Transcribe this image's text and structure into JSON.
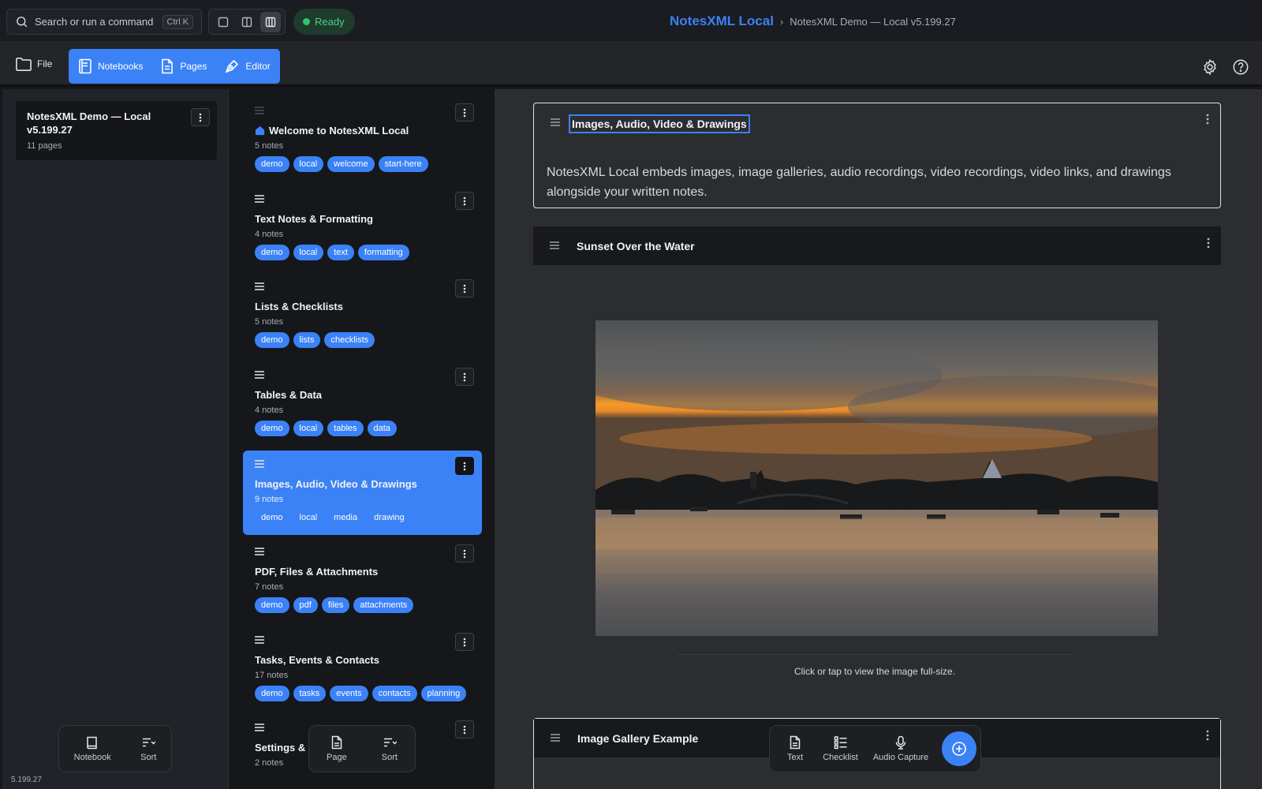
{
  "topbar": {
    "search_placeholder": "Search or run a command",
    "search_shortcut": "Ctrl K",
    "status": "Ready",
    "app_name": "NotesXML Local",
    "breadcrumb_separator": "›",
    "breadcrumb_current": "NotesXML Demo — Local v5.199.27"
  },
  "toolbar": {
    "file_label": "File",
    "notebooks_label": "Notebooks",
    "pages_label": "Pages",
    "editor_label": "Editor"
  },
  "notebooks": {
    "items": [
      {
        "title": "NotesXML Demo — Local v5.199.27",
        "pages": "11 pages"
      }
    ],
    "footer": {
      "notebook_label": "Notebook",
      "sort_label": "Sort"
    },
    "version": "5.199.27"
  },
  "pages": {
    "items": [
      {
        "title": "Welcome to NotesXML Local",
        "count": "5 notes",
        "tags": [
          "demo",
          "local",
          "welcome",
          "start-here"
        ]
      },
      {
        "title": "Text Notes & Formatting",
        "count": "4 notes",
        "tags": [
          "demo",
          "local",
          "text",
          "formatting"
        ]
      },
      {
        "title": "Lists & Checklists",
        "count": "5 notes",
        "tags": [
          "demo",
          "lists",
          "checklists"
        ]
      },
      {
        "title": "Tables & Data",
        "count": "4 notes",
        "tags": [
          "demo",
          "local",
          "tables",
          "data"
        ]
      },
      {
        "title": "Images, Audio, Video & Drawings",
        "count": "9 notes",
        "tags": [
          "demo",
          "local",
          "media",
          "drawing"
        ]
      },
      {
        "title": "PDF, Files & Attachments",
        "count": "7 notes",
        "tags": [
          "demo",
          "pdf",
          "files",
          "attachments"
        ]
      },
      {
        "title": "Tasks, Events & Contacts",
        "count": "17 notes",
        "tags": [
          "demo",
          "tasks",
          "events",
          "contacts",
          "planning"
        ]
      },
      {
        "title": "Settings &",
        "count": "2 notes",
        "tags": []
      }
    ],
    "selected_index": 4,
    "footer": {
      "page_label": "Page",
      "sort_label": "Sort"
    }
  },
  "editor": {
    "header_block": {
      "title": "Images, Audio, Video & Drawings",
      "body": "NotesXML Local embeds images, image galleries, audio recordings, video recordings, video links, and drawings alongside your written notes."
    },
    "image_block": {
      "title": "Sunset Over the Water",
      "caption": "Click or tap to view the image full-size."
    },
    "gallery_block": {
      "title": "Image Gallery Example"
    },
    "add_bar": {
      "text_label": "Text",
      "checklist_label": "Checklist",
      "audio_label": "Audio Capture"
    }
  },
  "colors": {
    "accent": "#3b82f6",
    "status_green": "#31c46e",
    "panel_dark": "#15171b",
    "editor_bg": "#2b2d31"
  }
}
